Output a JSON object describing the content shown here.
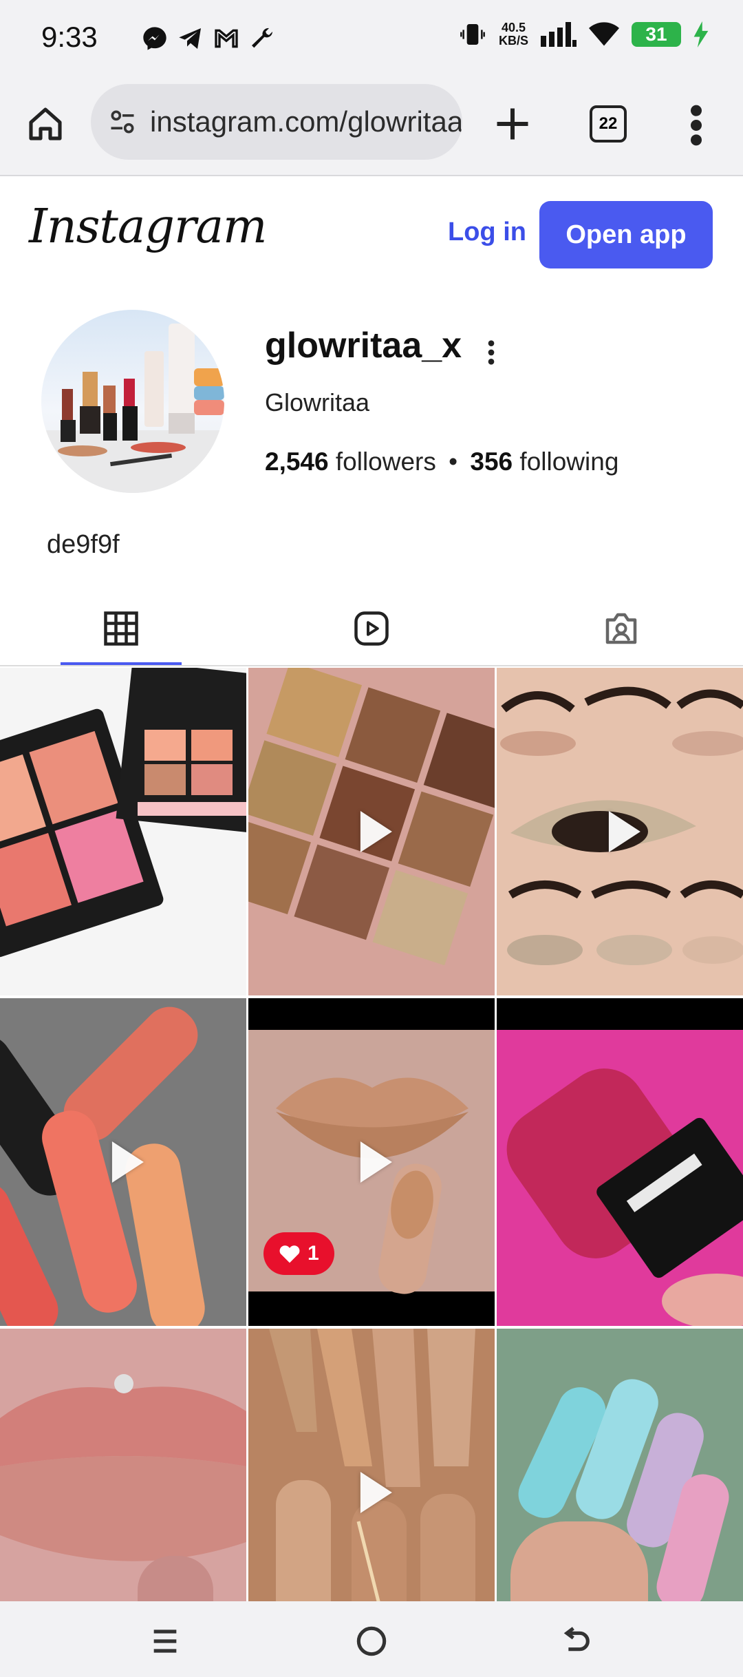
{
  "status_bar": {
    "time": "9:33",
    "net_speed_value": "40.5",
    "net_speed_unit": "KB/S",
    "battery": "31",
    "left_icons": [
      "messenger-icon",
      "telegram-icon",
      "gmail-icon",
      "wrench-icon"
    ],
    "right_icons": [
      "vibrate-icon",
      "signal-icon",
      "wifi-icon",
      "battery-icon",
      "charging-icon"
    ]
  },
  "browser": {
    "url": "instagram.com/glowritaa_x",
    "tab_count": "22"
  },
  "header": {
    "logo": "Instagram",
    "login_label": "Log in",
    "open_app_label": "Open app"
  },
  "profile": {
    "username": "glowritaa_x",
    "full_name": "Glowritaa",
    "followers_count": "2,546",
    "followers_label": "followers",
    "separator": "•",
    "following_count": "356",
    "following_label": "following",
    "bio": "de9f9f"
  },
  "tabs": [
    "posts-grid",
    "reels",
    "tagged"
  ],
  "posts": [
    {
      "theme": "elf cream blush palette",
      "is_video": false,
      "likes": ""
    },
    {
      "theme": "embossed eyeshadow palette",
      "is_video": true,
      "likes": ""
    },
    {
      "theme": "eye makeup steps",
      "is_video": true,
      "likes": ""
    },
    {
      "theme": "sugar lipsticks",
      "is_video": true,
      "likes": ""
    },
    {
      "theme": "glitter lips",
      "is_video": true,
      "likes": "1"
    },
    {
      "theme": "glitter lipstick pink",
      "is_video": false,
      "likes": ""
    },
    {
      "theme": "glitter lips pierced",
      "is_video": false,
      "likes": ""
    },
    {
      "theme": "nude nails",
      "is_video": true,
      "likes": ""
    },
    {
      "theme": "ombre nails",
      "is_video": false,
      "likes": ""
    }
  ],
  "colors": {
    "accent": "#4a5af0",
    "link": "#3b4ee8",
    "battery": "#2db34a",
    "like": "#e8102c"
  }
}
